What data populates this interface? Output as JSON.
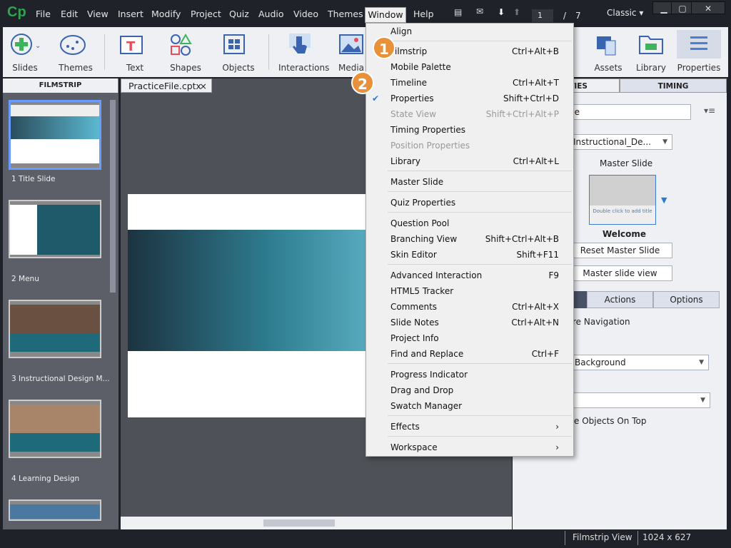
{
  "app": {
    "logo": "Cp",
    "menus": [
      "File",
      "Edit",
      "View",
      "Insert",
      "Modify",
      "Project",
      "Quiz",
      "Audio",
      "Video",
      "Themes",
      "Window",
      "Help"
    ],
    "page_current": "1",
    "page_sep": "/",
    "page_total": "7",
    "workspace": "Classic"
  },
  "toolbar": {
    "items": [
      "Slides",
      "Themes",
      "Text",
      "Shapes",
      "Objects",
      "Interactions",
      "Media",
      "Assets",
      "Library",
      "Properties"
    ]
  },
  "filmstrip": {
    "header": "FILMSTRIP",
    "slides": [
      "1 Title Slide",
      "2 Menu",
      "3 Instructional Design M...",
      "4 Learning Design"
    ]
  },
  "document": {
    "tab": "PracticeFile.cptx",
    "close": "×"
  },
  "properties": {
    "tabs": [
      "PROPERTIES",
      "TIMING"
    ],
    "tab_visible": "TIES",
    "name_value": "de",
    "master_dropdown": "Instructional_De...",
    "master_label": "Master Slide",
    "thumb_text": "Double click to add title",
    "master_name": "Welcome",
    "reset_button": "Reset Master Slide",
    "view_button": "Master slide view",
    "subtabs": [
      "Actions",
      "Options"
    ],
    "navigation_text": "re Navigation",
    "background_dropdown": "Background",
    "objects_on_top": "e Objects On Top"
  },
  "window_menu": {
    "items": [
      {
        "label": "Align",
        "shortcut": ""
      },
      {
        "label": "Filmstrip",
        "shortcut": "Ctrl+Alt+B"
      },
      {
        "label": "Mobile Palette",
        "shortcut": ""
      },
      {
        "label": "Timeline",
        "shortcut": "Ctrl+Alt+T"
      },
      {
        "label": "Properties",
        "shortcut": "Shift+Ctrl+D",
        "checked": true
      },
      {
        "label": "State View",
        "shortcut": "Shift+Ctrl+Alt+P",
        "disabled": true
      },
      {
        "label": "Timing Properties",
        "shortcut": ""
      },
      {
        "label": "Position Properties",
        "shortcut": "",
        "disabled": true
      },
      {
        "label": "Library",
        "shortcut": "Ctrl+Alt+L"
      },
      {
        "label": "Master Slide",
        "shortcut": ""
      },
      {
        "label": "Quiz Properties",
        "shortcut": ""
      },
      {
        "label": "Question Pool",
        "shortcut": ""
      },
      {
        "label": "Branching View",
        "shortcut": "Shift+Ctrl+Alt+B"
      },
      {
        "label": "Skin Editor",
        "shortcut": "Shift+F11"
      },
      {
        "label": "Advanced Interaction",
        "shortcut": "F9"
      },
      {
        "label": "HTML5 Tracker",
        "shortcut": ""
      },
      {
        "label": "Comments",
        "shortcut": "Ctrl+Alt+X"
      },
      {
        "label": "Slide Notes",
        "shortcut": "Ctrl+Alt+N"
      },
      {
        "label": "Project Info",
        "shortcut": ""
      },
      {
        "label": "Find and Replace",
        "shortcut": "Ctrl+F"
      },
      {
        "label": "Progress Indicator",
        "shortcut": ""
      },
      {
        "label": "Drag and Drop",
        "shortcut": ""
      },
      {
        "label": "Swatch Manager",
        "shortcut": ""
      },
      {
        "label": "Effects",
        "shortcut": "›"
      },
      {
        "label": "Workspace",
        "shortcut": "›"
      }
    ]
  },
  "callouts": [
    "1",
    "2"
  ],
  "status": {
    "view": "Filmstrip View",
    "size": "1024 x 627"
  },
  "colors": {
    "accent": "#2a7bd0",
    "callout": "#e8913a",
    "chrome": "#1f2229"
  }
}
